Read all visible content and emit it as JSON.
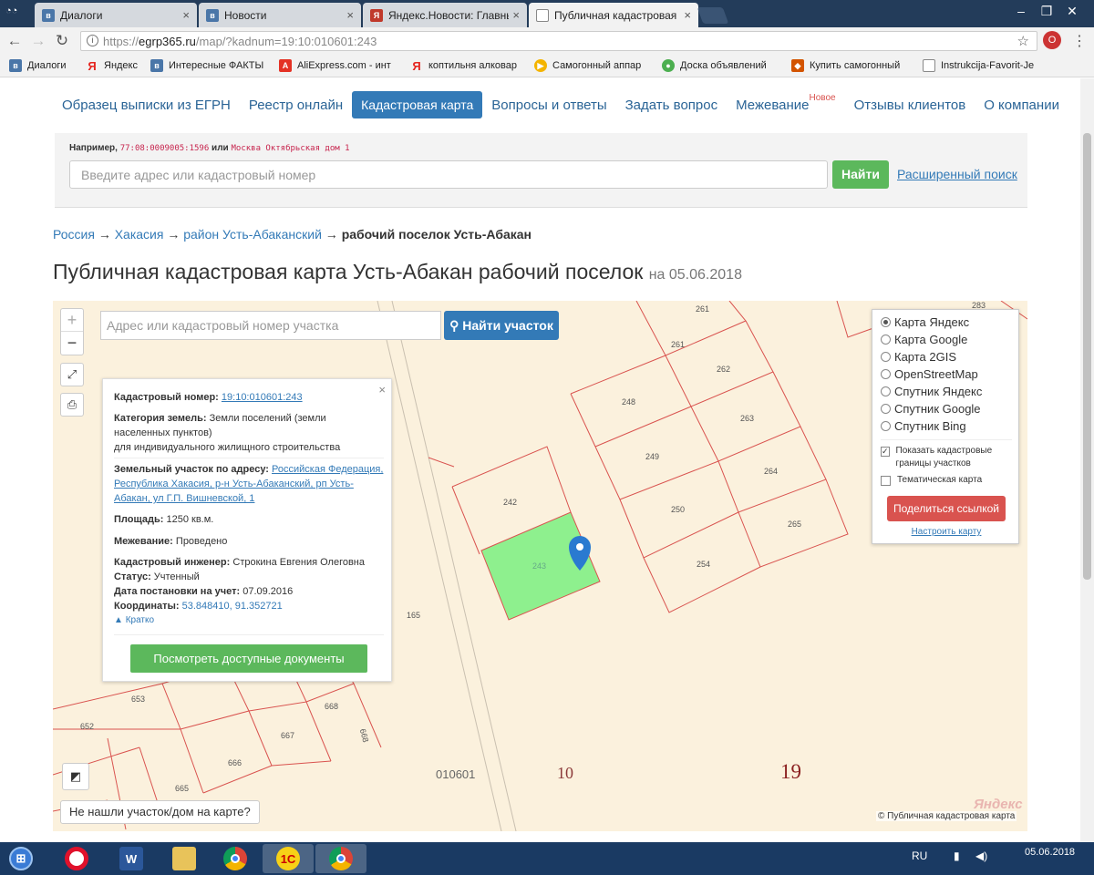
{
  "browser": {
    "tabs": [
      {
        "label": "Диалоги",
        "icon": "vk-icon",
        "color": "#4a76a8"
      },
      {
        "label": "Новости",
        "icon": "vk-icon",
        "color": "#4a76a8"
      },
      {
        "label": "Яндекс.Новости: Главны",
        "icon": "yandex-news-icon",
        "color": "#c0392b"
      },
      {
        "label": "Публичная кадастровая",
        "icon": "page-icon",
        "color": "#777777"
      }
    ],
    "url_prefix": "https://",
    "url_host": "egrp365.ru",
    "url_path": "/map/?kadnum=19:10:010601:243",
    "bookmarks": [
      {
        "label": "Диалоги",
        "icon": "vk-icon",
        "color": "#4a76a8"
      },
      {
        "label": "Яндекс",
        "icon": "yandex-icon",
        "color": "#e52620"
      },
      {
        "label": "Интересные ФАКТЫ",
        "icon": "vk-icon",
        "color": "#4a76a8"
      },
      {
        "label": "AliExpress.com - инт",
        "icon": "aliexpress-icon",
        "color": "#e43225"
      },
      {
        "label": "коптильня алковар",
        "icon": "yandex-icon",
        "color": "#e52620"
      },
      {
        "label": "Самогонный аппар",
        "icon": "play-icon",
        "color": "#f4b400"
      },
      {
        "label": "Доска объявлений",
        "icon": "avito-icon",
        "color": "#4caf50"
      },
      {
        "label": "Купить самогонный",
        "icon": "shop-icon",
        "color": "#d35400"
      },
      {
        "label": "Instrukcija-Favorit-Je",
        "icon": "doc-icon",
        "color": "#888888"
      }
    ]
  },
  "nav": {
    "items": [
      {
        "label": "Образец выписки из ЕГРН"
      },
      {
        "label": "Реестр онлайн"
      },
      {
        "label": "Кадастровая карта",
        "active": true
      },
      {
        "label": "Вопросы и ответы"
      },
      {
        "label": "Задать вопрос"
      },
      {
        "label": "Межевание",
        "badge": "Новое"
      },
      {
        "label": "Отзывы клиентов"
      },
      {
        "label": "О компании"
      }
    ]
  },
  "search": {
    "example_prefix": "Например,",
    "example_code1": "77:08:0009005:1596",
    "example_or": "или",
    "example_code2": "Москва Октябрьская дом 1",
    "placeholder": "Введите адрес или кадастровый номер",
    "button": "Найти",
    "advanced": "Расширенный поиск"
  },
  "breadcrumbs": {
    "items": [
      "Россия",
      "Хакасия",
      "район Усть-Абаканский"
    ],
    "arrow": "→",
    "current": "рабочий поселок Усть-Абакан"
  },
  "title": {
    "main": "Публичная кадастровая карта Усть-Абакан рабочий поселок",
    "date": "на 05.06.2018"
  },
  "map": {
    "search_placeholder": "Адрес или кадастровый номер участка",
    "find_button": "Найти участок",
    "zoom_in": "+",
    "zoom_out": "−",
    "highlight_color": "#8ef08e",
    "boundary_color": "#d9534f",
    "parcel_labels": [
      "261",
      "283",
      "261",
      "262",
      "248",
      "263",
      "249",
      "264",
      "242",
      "250",
      "265",
      "243",
      "254",
      "165",
      "653",
      "668",
      "652",
      "667",
      "668",
      "666",
      "665"
    ],
    "block_numbers": {
      "quarter": "010601",
      "district": "10",
      "region": "19"
    },
    "not_found": "Не нашли участок/дом на карте?",
    "copyright": "© Публичная кадастровая карта",
    "yandex_logo": "Яндекс"
  },
  "parcel": {
    "cadastral_label": "Кадастровый номер:",
    "cadastral_number": "19:10:010601:243",
    "category_label": "Категория земель:",
    "category_value": "Земли поселений (земли населенных пунктов)",
    "category_use": "для индивидуального жилищного строительства",
    "address_label": "Земельный участок по адресу:",
    "address_value": "Российская Федерация, Республика Хакасия, р-н Усть-Абаканский, рп Усть-Абакан, ул Г.П. Вишневской, 1",
    "area_label": "Площадь:",
    "area_value": "1250 кв.м.",
    "survey_label": "Межевание:",
    "survey_value": "Проведено",
    "engineer_label": "Кадастровый инженер:",
    "engineer_value": "Строкина Евгения Олеговна",
    "status_label": "Статус:",
    "status_value": "Учтенный",
    "reg_date_label": "Дата постановки на учет:",
    "reg_date_value": "07.09.2016",
    "coords_label": "Координаты:",
    "coords_value": "53.848410, 91.352721",
    "collapse": "Кратко",
    "docs_button": "Посмотреть доступные документы"
  },
  "layers": {
    "options": [
      {
        "label": "Карта Яндекс",
        "selected": true
      },
      {
        "label": "Карта Google",
        "selected": false
      },
      {
        "label": "Карта 2GIS",
        "selected": false
      },
      {
        "label": "OpenStreetMap",
        "selected": false
      },
      {
        "label": "Спутник Яндекс",
        "selected": false
      },
      {
        "label": "Спутник Google",
        "selected": false
      },
      {
        "label": "Спутник Bing",
        "selected": false
      }
    ],
    "show_borders": "Показать кадастровые границы участков",
    "show_borders_checked": true,
    "thematic": "Тематическая карта",
    "thematic_checked": false,
    "share_button": "Поделиться ссылкой",
    "configure": "Настроить карту"
  },
  "taskbar": {
    "lang": "RU",
    "date": "05.06.2018"
  }
}
